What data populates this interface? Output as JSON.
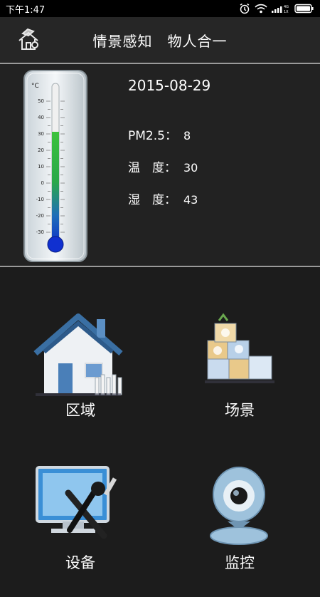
{
  "status": {
    "time": "下午1:47"
  },
  "header": {
    "title": "情景感知　物人合一"
  },
  "thermometer": {
    "unit": "°C",
    "ticks": [
      "50",
      "40",
      "30",
      "20",
      "10",
      "0",
      "-10",
      "-20",
      "-30"
    ]
  },
  "info": {
    "date": "2015-08-29",
    "pm25_label": "PM2.5：",
    "pm25_value": "8",
    "temp_label": "温　度：",
    "temp_value": "30",
    "humidity_label": "湿　度：",
    "humidity_value": "43"
  },
  "menu": {
    "area": "区域",
    "scene": "场景",
    "device": "设备",
    "monitor": "监控"
  }
}
